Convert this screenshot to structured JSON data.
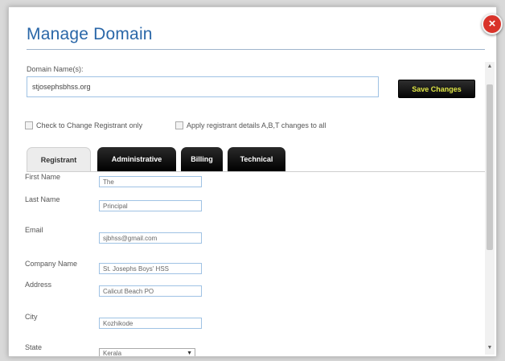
{
  "dialog": {
    "title": "Manage Domain",
    "close_icon": "close-icon",
    "close_label": "×"
  },
  "domain": {
    "label": "Domain Name(s):",
    "value": "stjosephsbhss.org",
    "save_label": "Save Changes"
  },
  "options": {
    "change_registrant_only": "Check to Change Registrant only",
    "apply_all": "Apply registrant details A,B,T changes to all"
  },
  "tabs": [
    {
      "label": "Registrant"
    },
    {
      "label": "Administrative"
    },
    {
      "label": "Billing"
    },
    {
      "label": "Technical"
    }
  ],
  "form": {
    "first_name": {
      "label": "First Name",
      "value": "The"
    },
    "last_name": {
      "label": "Last Name",
      "value": "Principal"
    },
    "email": {
      "label": "Email",
      "value": "sjbhss@gmail.com"
    },
    "company": {
      "label": "Company Name",
      "value": "St. Josephs Boys' HSS"
    },
    "address": {
      "label": "Address",
      "value": "Calicut Beach PO"
    },
    "city": {
      "label": "City",
      "value": "Kozhikode"
    },
    "state": {
      "label": "State",
      "value": "Kerala"
    }
  },
  "scrollbar": {
    "up_arrow": "▲",
    "down_arrow": "▼"
  }
}
